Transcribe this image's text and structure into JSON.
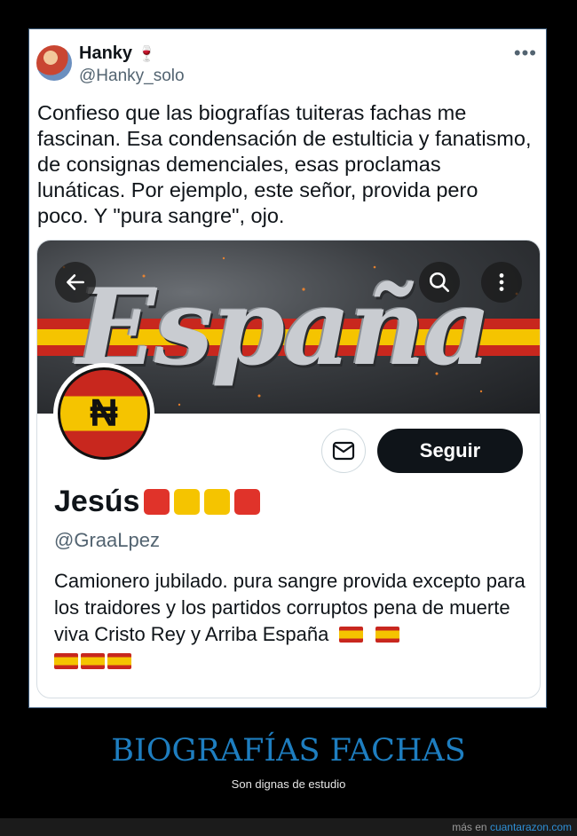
{
  "tweet": {
    "author_name": "Hanky",
    "author_emoji": "🍷",
    "author_handle": "@Hanky_solo",
    "more_icon": "more-dots-icon",
    "text": "Confieso que las biografías tuiteras fachas me fascinan. Esa condensación de estulticia y fanatismo, de consignas demenciales, esas proclamas lunáticas. Por ejemplo, este señor, provida pero poco. Y \"pura sangre\", ojo."
  },
  "embedded_profile": {
    "banner_title": "España",
    "avatar_symbol": "₦",
    "name": "Jesús",
    "name_squares": [
      "#e0332a",
      "#f5c400",
      "#f5c400",
      "#e0332a"
    ],
    "handle": "@GraaLpez",
    "follow_label": "Seguir",
    "bio_text": "Camionero jubilado. pura sangre provida excepto para los traidores y los partidos corruptos pena de muerte viva Cristo Rey y Arriba España",
    "bio_flags_line1": 2,
    "bio_flags_line2": 3,
    "icons": [
      "back-arrow-icon",
      "search-icon",
      "more-vertical-icon",
      "mail-icon"
    ]
  },
  "caption": {
    "title": "BIOGRAFÍAS FACHAS",
    "subtitle": "Son dignas de estudio"
  },
  "footer": {
    "prefix": "más en",
    "site": "cuantarazon.com"
  },
  "colors": {
    "accent_blue": "#1e7ec0",
    "flag_red": "#c8271e",
    "flag_yellow": "#f5c400",
    "button_dark": "#0f1419"
  }
}
